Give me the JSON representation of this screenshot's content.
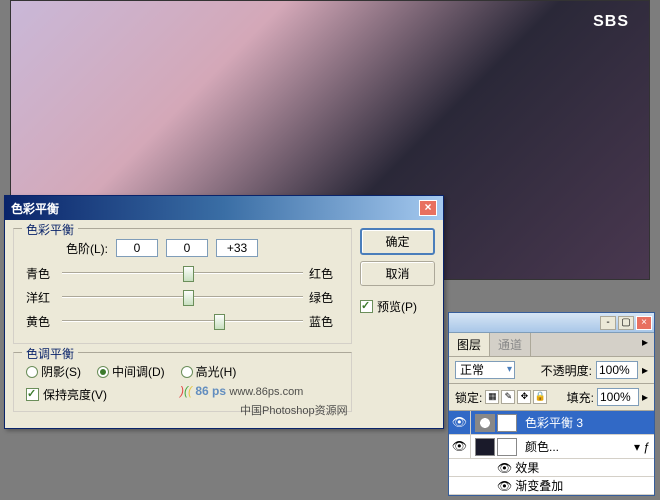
{
  "canvas": {
    "watermark_logo": "SBS"
  },
  "dialog": {
    "title": "色彩平衡",
    "group1_title": "色彩平衡",
    "levels_label": "色阶(L):",
    "levels": {
      "v1": "0",
      "v2": "0",
      "v3": "+33"
    },
    "sliders": {
      "cyan": "青色",
      "red": "红色",
      "magenta": "洋红",
      "green": "绿色",
      "yellow": "黄色",
      "blue": "蓝色"
    },
    "group2_title": "色调平衡",
    "tones": {
      "shadows": "阴影(S)",
      "midtones": "中间调(D)",
      "highlights": "高光(H)"
    },
    "preserve_lum": "保持亮度(V)",
    "buttons": {
      "ok": "确定",
      "cancel": "取消",
      "preview": "预览(P)"
    }
  },
  "panel": {
    "tabs": {
      "layers": "图层",
      "channels": "通道"
    },
    "blend_mode": "正常",
    "opacity_label": "不透明度:",
    "opacity_value": "100%",
    "lock_label": "锁定:",
    "fill_label": "填充:",
    "fill_value": "100%",
    "layers": {
      "l1": "色彩平衡 3",
      "l2": "颜色...",
      "effect": "效果",
      "grad": "渐变叠加"
    }
  },
  "watermark": {
    "site": "86 ps",
    "url": "www.86ps.com",
    "cn": "中国Photoshop资源网"
  }
}
